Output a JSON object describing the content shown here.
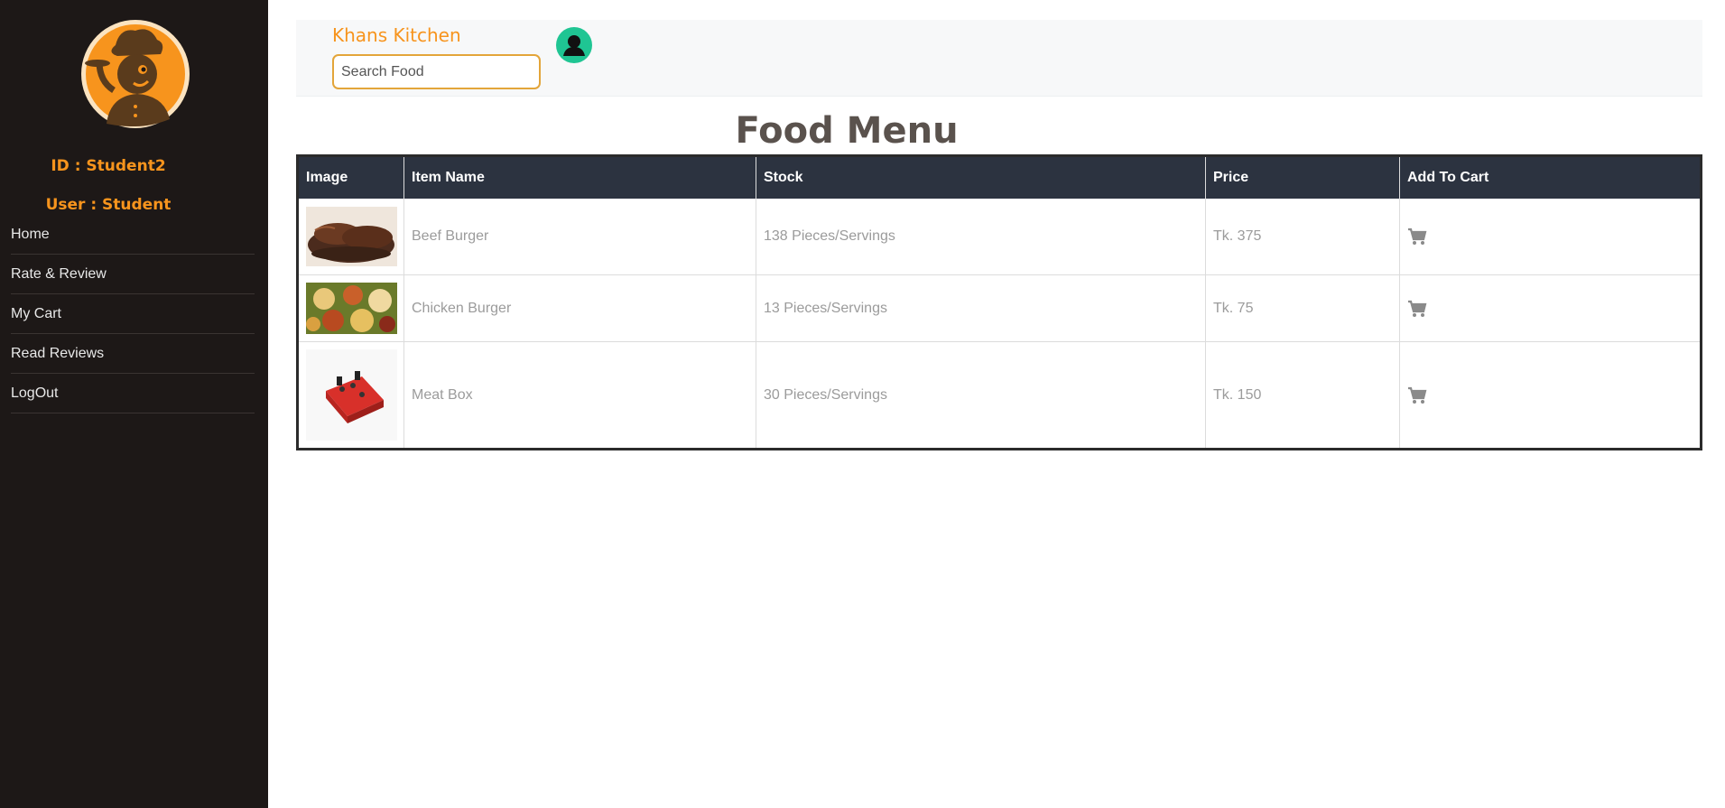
{
  "sidebar": {
    "id_line": "ID : Student2",
    "user_line": "User : Student",
    "nav": [
      {
        "label": "Home"
      },
      {
        "label": "Rate & Review"
      },
      {
        "label": "My Cart"
      },
      {
        "label": "Read Reviews"
      },
      {
        "label": "LogOut"
      }
    ]
  },
  "header": {
    "brand": "Khans Kitchen",
    "search_placeholder": "Search Food"
  },
  "main": {
    "title": "Food Menu",
    "columns": [
      "Image",
      "Item Name",
      "Stock",
      "Price",
      "Add To Cart"
    ],
    "rows": [
      {
        "name": "Beef Burger",
        "stock": "138 Pieces/Servings",
        "price": "Tk. 375"
      },
      {
        "name": "Chicken Burger",
        "stock": "13 Pieces/Servings",
        "price": "Tk. 75"
      },
      {
        "name": "Meat Box",
        "stock": "30 Pieces/Servings",
        "price": "Tk. 150"
      }
    ]
  },
  "colors": {
    "sidebar_bg": "#1d1817",
    "accent": "#f7941d",
    "table_header_bg": "#2c3340",
    "avatar_bg": "#1fc593"
  },
  "icons": [
    "chef-logo-icon",
    "user-avatar-icon",
    "cart-icon"
  ]
}
